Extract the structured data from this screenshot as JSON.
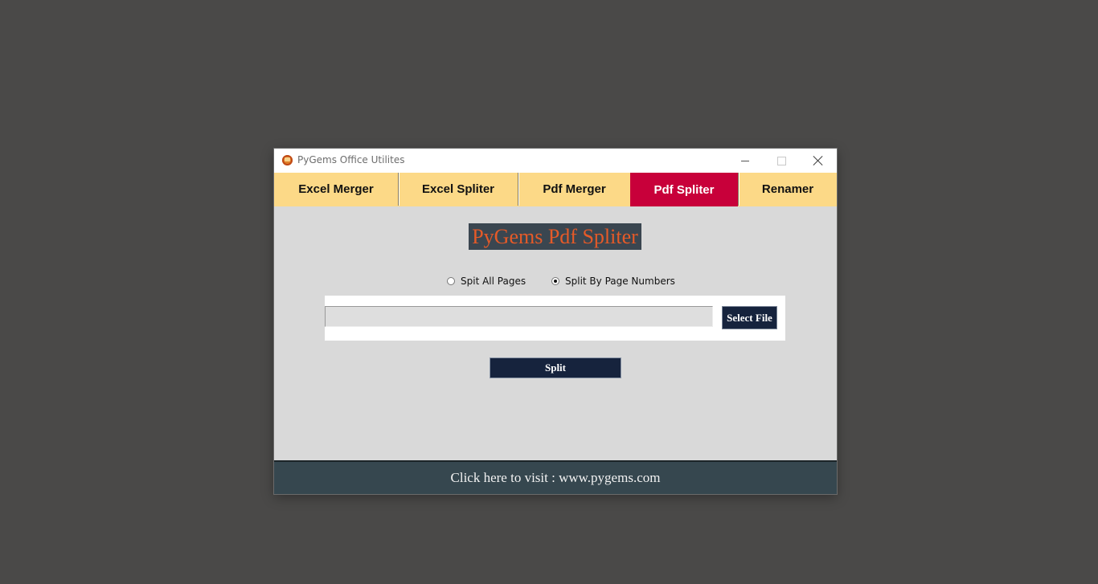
{
  "window": {
    "title": "PyGems Office Utilites"
  },
  "tabs": [
    {
      "label": "Excel Merger"
    },
    {
      "label": "Excel Spliter"
    },
    {
      "label": "Pdf Merger"
    },
    {
      "label": "Pdf Spliter",
      "active": true
    },
    {
      "label": "Renamer"
    }
  ],
  "main": {
    "title": "PyGems Pdf Spliter",
    "radios": [
      {
        "label": "Spit All Pages",
        "checked": false
      },
      {
        "label": "Split By Page Numbers",
        "checked": true
      }
    ],
    "file_path_value": "",
    "select_file_label": "Select File",
    "split_label": "Split"
  },
  "footer": {
    "link_text": "Click here to visit : www.pygems.com"
  },
  "colors": {
    "desktop": "#4a4948",
    "tab_bar": "#fcd987",
    "tab_active": "#c8003a",
    "title_bg": "#3a4650",
    "title_text": "#e55a28",
    "button_bg": "#16233d",
    "footer_bg": "#36474f"
  },
  "icons": [
    "app-icon",
    "minimize-icon",
    "maximize-icon",
    "close-icon"
  ]
}
